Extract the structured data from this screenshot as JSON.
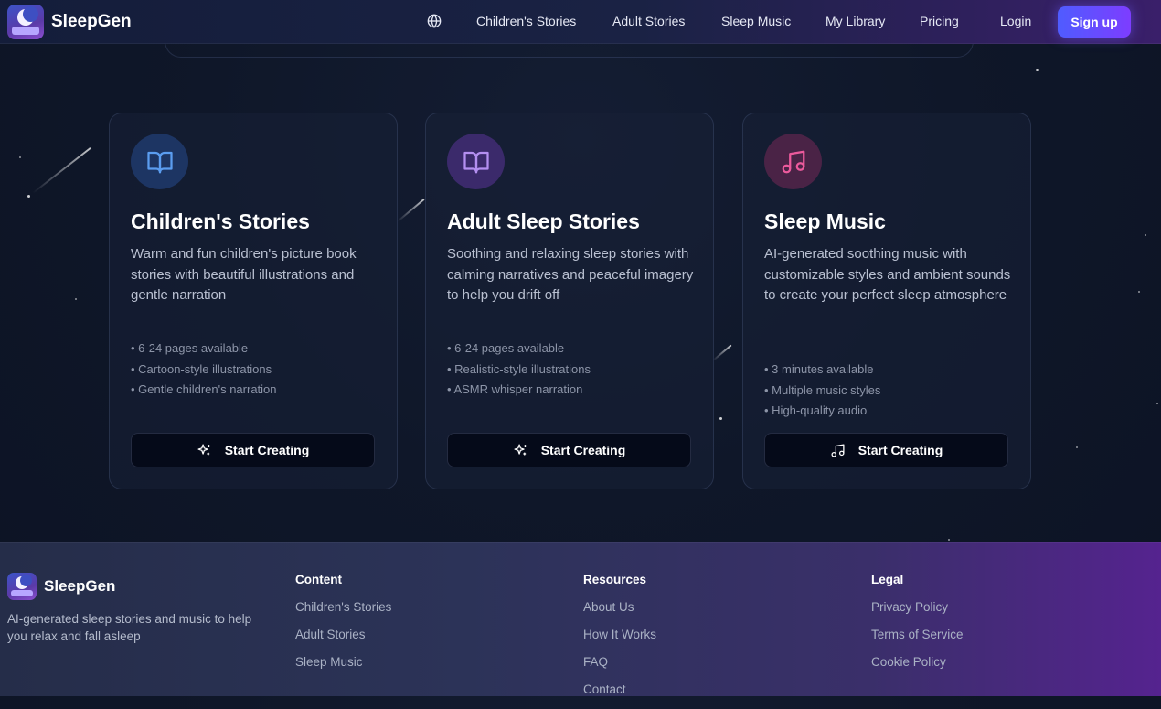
{
  "nav": {
    "brand": "SleepGen",
    "links": [
      "Children's Stories",
      "Adult Stories",
      "Sleep Music",
      "My Library",
      "Pricing"
    ],
    "login": "Login",
    "signup": "Sign up"
  },
  "cards": [
    {
      "title": "Children's Stories",
      "description": "Warm and fun children's picture book stories with beautiful illustrations and gentle narration",
      "features": [
        "6-24 pages available",
        "Cartoon-style illustrations",
        "Gentle children's narration"
      ],
      "button": "Start Creating",
      "icon": "book-icon",
      "accent": "#4f8fe0"
    },
    {
      "title": "Adult Sleep Stories",
      "description": "Soothing and relaxing sleep stories with calming narratives and peaceful imagery to help you drift off",
      "features": [
        "6-24 pages available",
        "Realistic-style illustrations",
        "ASMR whisper narration"
      ],
      "button": "Start Creating",
      "icon": "book-icon",
      "accent": "#a77be8"
    },
    {
      "title": "Sleep Music",
      "description": "AI-generated soothing music with customizable styles and ambient sounds to create your perfect sleep atmosphere",
      "features": [
        "3 minutes available",
        "Multiple music styles",
        "High-quality audio"
      ],
      "button": "Start Creating",
      "icon": "music-note-icon",
      "accent": "#e0508f"
    }
  ],
  "footer": {
    "brand": "SleepGen",
    "tagline": "AI-generated sleep stories and music to help you relax and fall asleep",
    "columns": [
      {
        "title": "Content",
        "links": [
          "Children's Stories",
          "Adult Stories",
          "Sleep Music"
        ]
      },
      {
        "title": "Resources",
        "links": [
          "About Us",
          "How It Works",
          "FAQ",
          "Contact"
        ]
      },
      {
        "title": "Legal",
        "links": [
          "Privacy Policy",
          "Terms of Service",
          "Cookie Policy"
        ]
      }
    ]
  }
}
